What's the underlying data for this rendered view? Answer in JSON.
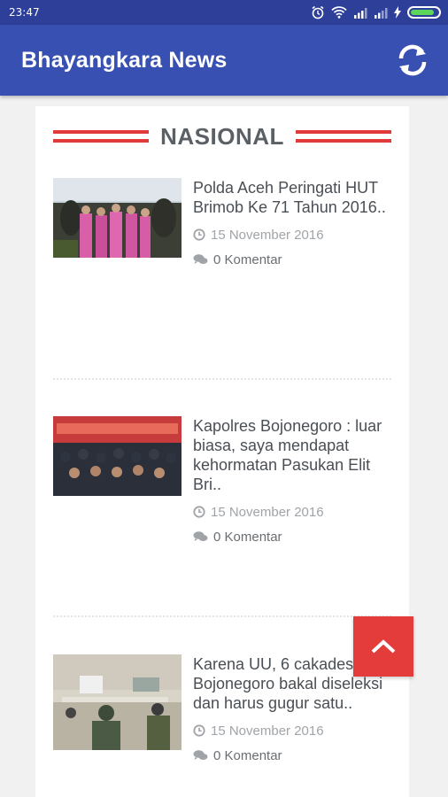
{
  "status_bar": {
    "time": "23:47",
    "icons": [
      "alarm-icon",
      "wifi-icon",
      "signal-icon",
      "signal-icon",
      "charging-icon",
      "battery-icon"
    ]
  },
  "app_bar": {
    "title": "Bhayangkara News",
    "action_icon": "refresh-icon"
  },
  "section": {
    "title": "NASIONAL",
    "accent_color": "#e03a3a"
  },
  "articles": [
    {
      "title": "Polda Aceh Peringati HUT Brimob Ke 71 Tahun 2016..",
      "date": "15 November 2016",
      "comments": "0 Komentar"
    },
    {
      "title": "Kapolres Bojonegoro : luar biasa, saya mendapat kehormatan Pasukan Elit Bri..",
      "date": "15 November 2016",
      "comments": "0 Komentar"
    },
    {
      "title": "Karena UU, 6 cakades Bojonegoro bakal diseleksi dan harus gugur satu..",
      "date": "15 November 2016",
      "comments": "0 Komentar"
    }
  ],
  "fab": {
    "icon": "chevron-up-icon",
    "color": "#e43b3b"
  },
  "colors": {
    "status_bar": "#2d3f99",
    "app_bar": "#3750b2",
    "background": "#f1f1f1"
  }
}
